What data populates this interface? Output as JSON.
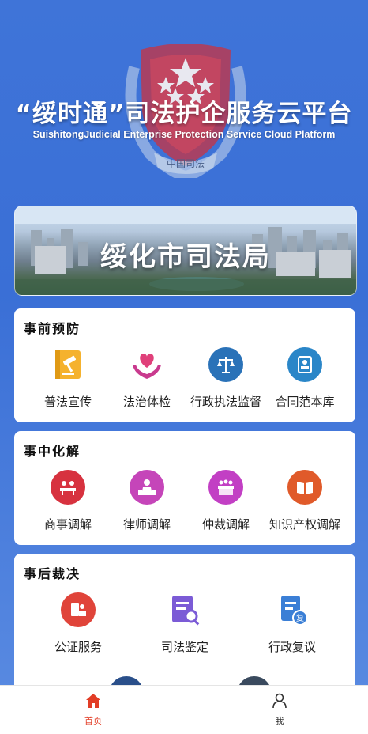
{
  "header": {
    "title_cn": "“绥时通”司法护企服务云平台",
    "title_en": "SuishitongJudicial Enterprise Protection Service Cloud Platform",
    "emblem_text": "中国司法"
  },
  "banner": {
    "title": "绥化市司法局"
  },
  "sections": [
    {
      "title": "事前预防",
      "items": [
        {
          "label": "普法宣传",
          "icon": "gavel-book-icon"
        },
        {
          "label": "法治体检",
          "icon": "heart-hands-icon"
        },
        {
          "label": "行政执法监督",
          "icon": "scales-icon"
        },
        {
          "label": "合同范本库",
          "icon": "contract-icon"
        }
      ]
    },
    {
      "title": "事中化解",
      "items": [
        {
          "label": "商事调解",
          "icon": "meeting-icon"
        },
        {
          "label": "律师调解",
          "icon": "lawyer-icon"
        },
        {
          "label": "仲裁调解",
          "icon": "arbitration-icon"
        },
        {
          "label": "知识产权调解",
          "icon": "book-icon"
        }
      ]
    },
    {
      "title": "事后裁决",
      "items": [
        {
          "label": "公证服务",
          "icon": "notary-icon"
        },
        {
          "label": "司法鉴定",
          "icon": "document-search-icon"
        },
        {
          "label": "行政复议",
          "icon": "review-icon"
        }
      ]
    }
  ],
  "nav": {
    "home": "首页",
    "me": "我"
  },
  "colors": {
    "accent": "#e23d26",
    "background": "#3f74d8"
  }
}
